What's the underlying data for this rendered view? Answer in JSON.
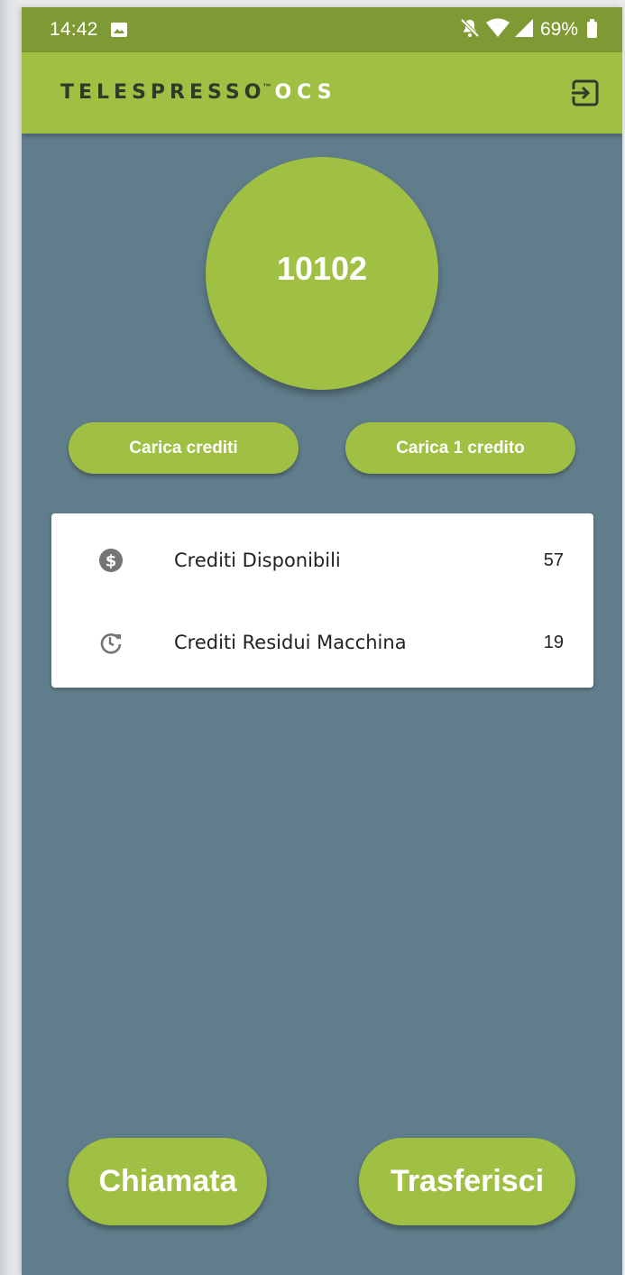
{
  "status_bar": {
    "time": "14:42",
    "battery_percent": "69%",
    "icons": [
      "image-icon",
      "bell-off-icon",
      "wifi-icon",
      "signal-icon",
      "battery-icon"
    ]
  },
  "app_bar": {
    "logo_main": "TELESPRESSO",
    "logo_tm": "™",
    "logo_suffix": "OCS",
    "logout_icon": "logout-icon"
  },
  "user": {
    "code": "10102"
  },
  "load_buttons": {
    "load_credits_label": "Carica crediti",
    "load_one_label": "Carica 1 credito"
  },
  "credits": {
    "items": [
      {
        "icon": "dollar-circle-icon",
        "label": "Crediti Disponibili",
        "value": "57"
      },
      {
        "icon": "clock-refresh-icon",
        "label": "Crediti Residui Macchina",
        "value": "19"
      }
    ]
  },
  "actions": {
    "call_label": "Chiamata",
    "transfer_label": "Trasferisci"
  },
  "colors": {
    "accent": "#a0c043",
    "status_bar": "#7f9a34",
    "background": "#607d8b",
    "card": "#ffffff"
  }
}
